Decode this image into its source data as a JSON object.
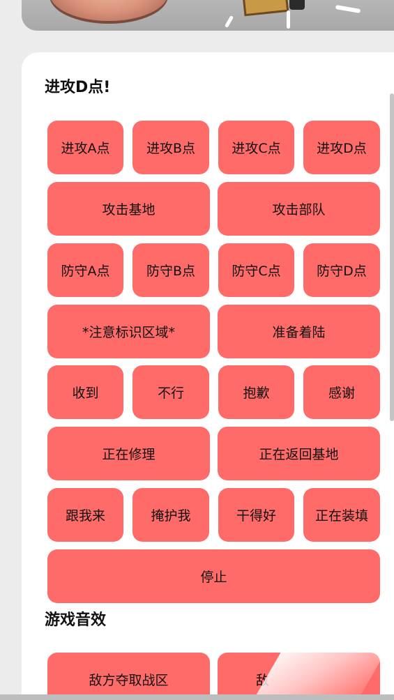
{
  "sections": [
    {
      "title": "进攻D点!",
      "buttons": [
        "进攻A点",
        "进攻B点",
        "进攻C点",
        "进攻D点",
        "攻击基地",
        "攻击部队",
        "防守A点",
        "防守B点",
        "防守C点",
        "防守D点",
        "*注意标识区域*",
        "准备着陆",
        "收到",
        "不行",
        "抱歉",
        "感谢",
        "正在修理",
        "正在返回基地",
        "跟我来",
        "掩护我",
        "干得好",
        "正在装填",
        "停止"
      ]
    },
    {
      "title": "游戏音效",
      "buttons": [
        "敌方夺取战区",
        "敌"
      ]
    }
  ],
  "colors": {
    "button": "#ff6b68",
    "card": "#ffffff",
    "background": "#ececec"
  }
}
